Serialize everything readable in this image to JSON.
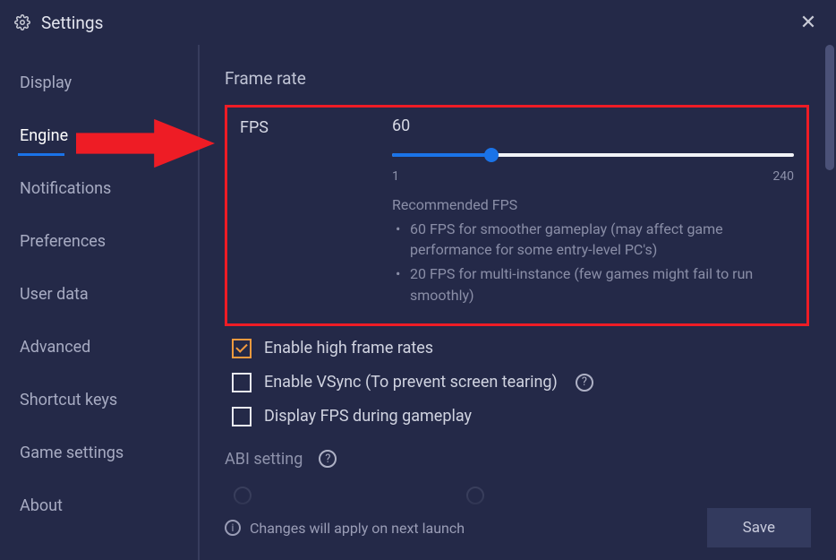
{
  "window": {
    "title": "Settings"
  },
  "sidebar": {
    "items": [
      {
        "label": "Display"
      },
      {
        "label": "Engine",
        "active": true
      },
      {
        "label": "Notifications"
      },
      {
        "label": "Preferences"
      },
      {
        "label": "User data"
      },
      {
        "label": "Advanced"
      },
      {
        "label": "Shortcut keys"
      },
      {
        "label": "Game settings"
      },
      {
        "label": "About"
      }
    ]
  },
  "frame_rate": {
    "section_title": "Frame rate",
    "label": "FPS",
    "value": "60",
    "min_label": "1",
    "max_label": "240",
    "min": 1,
    "max": 240,
    "recommend_title": "Recommended FPS",
    "recommend_1": "60 FPS for smoother gameplay (may affect game performance for some entry-level PC's)",
    "recommend_2": "20 FPS for multi-instance (few games might fail to run smoothly)"
  },
  "checks": {
    "high_fps": "Enable high frame rates",
    "vsync": "Enable VSync (To prevent screen tearing)",
    "show_fps": "Display FPS during gameplay"
  },
  "abi": {
    "title": "ABI setting"
  },
  "footer": {
    "notice": "Changes will apply on next launch",
    "save": "Save"
  },
  "annotation": {
    "arrow_color": "#ee1c25"
  }
}
